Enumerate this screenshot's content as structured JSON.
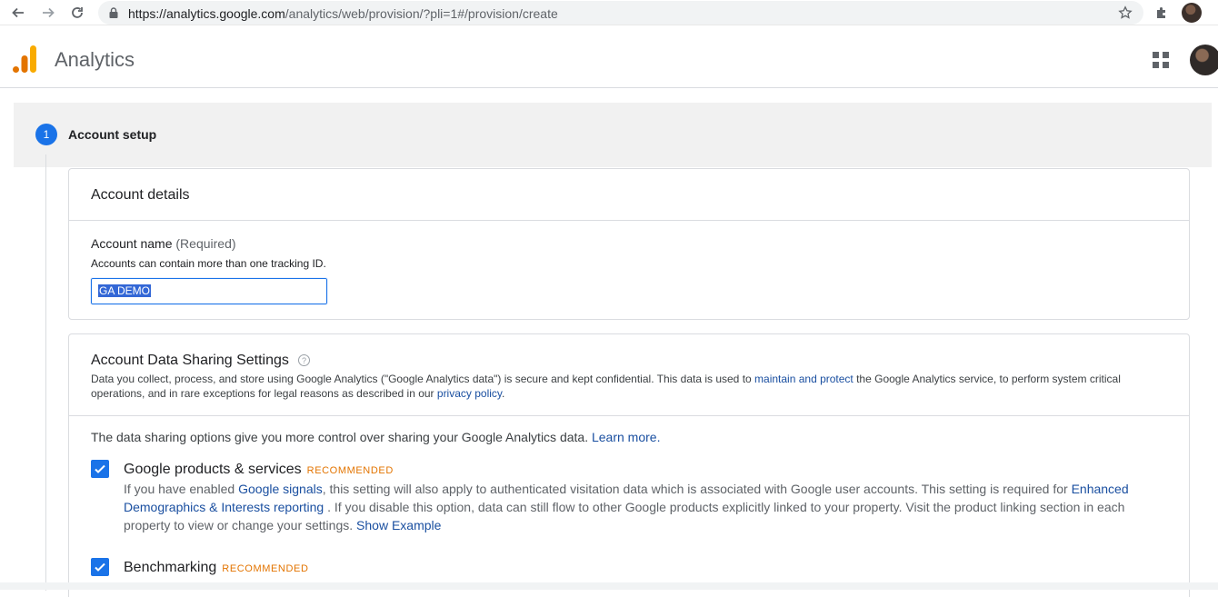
{
  "browser": {
    "url_host": "https://analytics.google.com",
    "url_path": "/analytics/web/provision/?pli=1#/provision/create"
  },
  "header": {
    "app_title": "Analytics"
  },
  "step": {
    "number": "1",
    "label": "Account setup"
  },
  "account_details": {
    "title": "Account details",
    "field_label": "Account name",
    "field_required": "(Required)",
    "field_help": "Accounts can contain more than one tracking ID.",
    "field_value": "GA DEMO"
  },
  "sharing": {
    "title": "Account Data Sharing Settings",
    "help_glyph": "?",
    "desc_part1": "Data you collect, process, and store using Google Analytics (\"Google Analytics data\") is secure and kept confidential. This data is used to ",
    "desc_link1": "maintain and protect",
    "desc_part2": " the Google Analytics service, to perform system critical operations, and in rare exceptions for legal reasons as described in our ",
    "desc_link2": "privacy policy",
    "desc_part3": ".",
    "intro_text": "The data sharing options give you more control over sharing your Google Analytics data. ",
    "intro_link": "Learn more.",
    "options": [
      {
        "title": "Google products & services",
        "badge": "RECOMMENDED",
        "checked": true,
        "desc_part1": "If you have enabled ",
        "desc_link1": "Google signals",
        "desc_part2": ", this setting will also apply to authenticated visitation data which is associated with Google user accounts. This setting is required for ",
        "desc_link2": "Enhanced Demographics & Interests reporting",
        "desc_part3": " . If you disable this option, data can still flow to other Google products explicitly linked to your property. Visit the product linking section in each property to view or change your settings. ",
        "desc_link3": "Show Example"
      },
      {
        "title": "Benchmarking",
        "badge": "RECOMMENDED",
        "checked": true
      }
    ]
  },
  "colors": {
    "primary": "#1a73e8",
    "badge": "#e37400",
    "link": "#1a4fa0"
  }
}
